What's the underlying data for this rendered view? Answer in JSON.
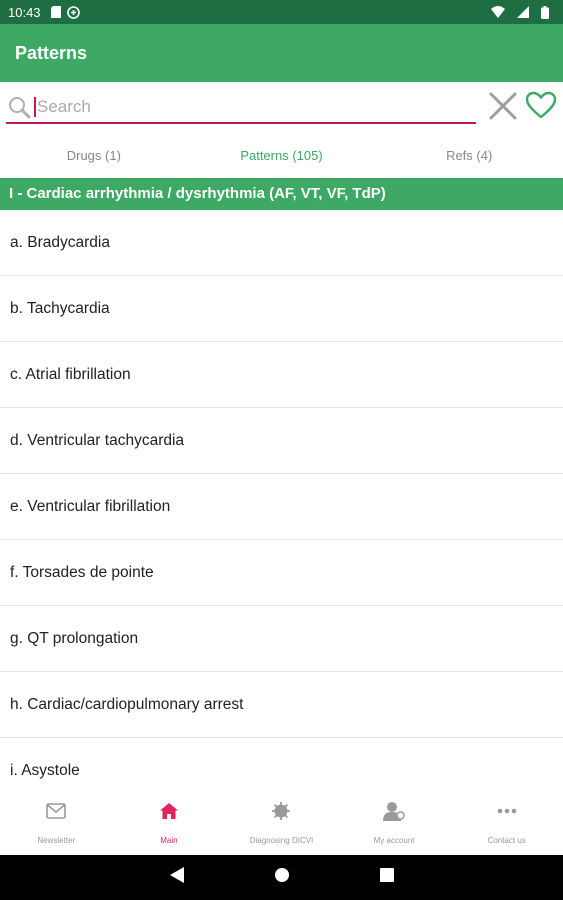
{
  "status_bar": {
    "time": "10:43",
    "left_icons": [
      "sd-card-icon",
      "vpn-icon"
    ],
    "right_icons": [
      "wifi-icon",
      "signal-icon",
      "battery-icon"
    ]
  },
  "app_bar": {
    "title": "Patterns"
  },
  "search": {
    "placeholder": "Search",
    "value": ""
  },
  "tabs": [
    {
      "label": "Drugs (1)",
      "active": false
    },
    {
      "label": "Patterns (105)",
      "active": true
    },
    {
      "label": "Refs (4)",
      "active": false
    }
  ],
  "section": {
    "title": "I - Cardiac arrhythmia / dysrhythmia (AF, VT, VF, TdP)"
  },
  "items": [
    "a. Bradycardia",
    "b. Tachycardia",
    "c. Atrial fibrillation",
    "d. Ventricular tachycardia",
    "e. Ventricular fibrillation",
    "f. Torsades de pointe",
    "g. QT prolongation",
    "h. Cardiac/cardiopulmonary arrest",
    "i. Asystole"
  ],
  "bottom_nav": [
    {
      "label": "Newsletter",
      "icon": "mail-icon",
      "active": false
    },
    {
      "label": "Main",
      "icon": "home-icon",
      "active": true
    },
    {
      "label": "Diagnosing DICVI",
      "icon": "virus-icon",
      "active": false
    },
    {
      "label": "My account",
      "icon": "account-icon",
      "active": false
    },
    {
      "label": "Contact us",
      "icon": "more-icon",
      "active": false
    }
  ],
  "colors": {
    "status_bar": "#1f6e43",
    "primary": "#3ea865",
    "search_underline": "#c2185b",
    "nav_active": "#e0245e",
    "nav_inactive": "#999999"
  }
}
